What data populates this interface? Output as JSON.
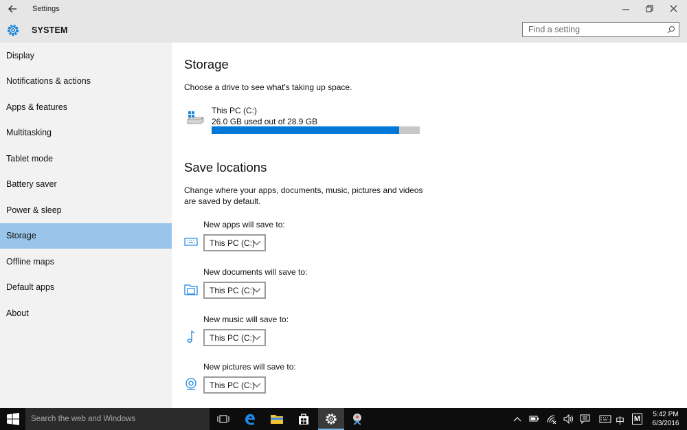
{
  "window": {
    "title": "Settings",
    "section_title": "SYSTEM",
    "search_placeholder": "Find a setting"
  },
  "sidebar": {
    "items": [
      {
        "label": "Display"
      },
      {
        "label": "Notifications & actions"
      },
      {
        "label": "Apps & features"
      },
      {
        "label": "Multitasking"
      },
      {
        "label": "Tablet mode"
      },
      {
        "label": "Battery saver"
      },
      {
        "label": "Power & sleep"
      },
      {
        "label": "Storage"
      },
      {
        "label": "Offline maps"
      },
      {
        "label": "Default apps"
      },
      {
        "label": "About"
      }
    ],
    "active_index": 7
  },
  "storage": {
    "heading": "Storage",
    "description": "Choose a drive to see what's taking up space.",
    "drive": {
      "name": "This PC (C:)",
      "usage": "26.0 GB used out of 28.9 GB",
      "used_fraction": 0.9
    }
  },
  "save_locations": {
    "heading": "Save locations",
    "description_line1": "Change where your apps, documents, music, pictures and videos",
    "description_line2": "are saved by default.",
    "items": [
      {
        "label": "New apps will save to:",
        "value": "This PC (C:)",
        "icon": "keyboard-icon"
      },
      {
        "label": "New documents will save to:",
        "value": "This PC (C:)",
        "icon": "documents-folder-icon"
      },
      {
        "label": "New music will save to:",
        "value": "This PC (C:)",
        "icon": "music-note-icon"
      },
      {
        "label": "New pictures will save to:",
        "value": "This PC (C:)",
        "icon": "camera-icon"
      }
    ]
  },
  "taskbar": {
    "search_placeholder": "Search the web and Windows",
    "ime_label": "中",
    "ime_mode": "M",
    "time": "5:42 PM",
    "date": "6/3/2016"
  },
  "colors": {
    "accent": "#0078d7",
    "selected_nav": "#9ac5ea",
    "sidebar_bg": "#f2f2f2",
    "titlebar_bg": "#e6e6e6",
    "taskbar_bg": "#0d0d0d"
  }
}
